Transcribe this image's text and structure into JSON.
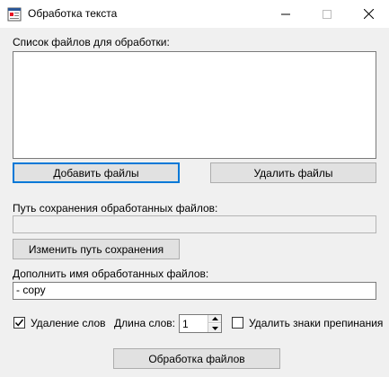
{
  "window": {
    "title": "Обработка текста",
    "app_icon": "form-app-icon",
    "controls": {
      "minimize": "minimize-icon",
      "maximize": "maximize-icon",
      "close": "close-icon"
    }
  },
  "files": {
    "label": "Список файлов для обработки:",
    "items": [],
    "add_button": "Добавить файлы",
    "remove_button": "Удалить файлы"
  },
  "save_path": {
    "label": "Путь сохранения обработанных файлов:",
    "value": "",
    "change_button": "Изменить путь сохранения"
  },
  "suffix": {
    "label": "Дополнить имя обработанных файлов:",
    "value": "- copy"
  },
  "options": {
    "remove_words": {
      "label": "Удаление слов",
      "checked": true
    },
    "word_length": {
      "label": "Длина слов:",
      "value": "1"
    },
    "remove_punctuation": {
      "label": "Удалить знаки препинания",
      "checked": false
    }
  },
  "process_button": "Обработка файлов",
  "colors": {
    "focus_border": "#0078d7",
    "button_face": "#e1e1e1",
    "window_bg": "#f0f0f0"
  }
}
